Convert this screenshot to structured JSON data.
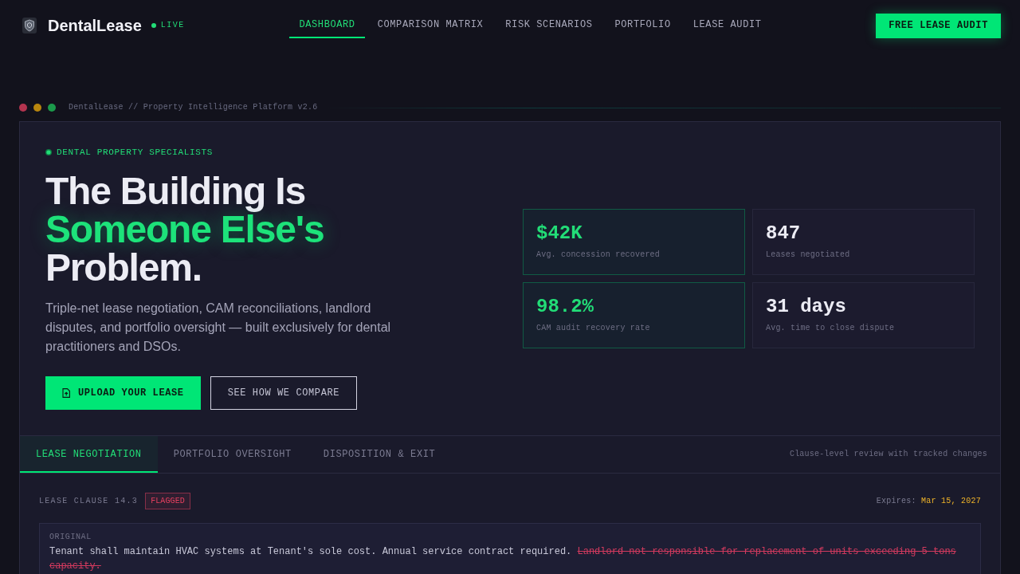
{
  "header": {
    "brand": "DentalLease",
    "status": "LIVE",
    "nav": [
      {
        "label": "DASHBOARD",
        "selected": true
      },
      {
        "label": "COMPARISON MATRIX",
        "selected": false
      },
      {
        "label": "RISK SCENARIOS",
        "selected": false
      },
      {
        "label": "PORTFOLIO",
        "selected": false
      },
      {
        "label": "LEASE AUDIT",
        "selected": false
      }
    ],
    "cta": "FREE LEASE AUDIT"
  },
  "window_bar": {
    "title": "DentalLease // Property Intelligence Platform v2.6"
  },
  "hero": {
    "eyebrow": "DENTAL PROPERTY SPECIALISTS",
    "headline": [
      {
        "text": "The Building Is",
        "accent": false
      },
      {
        "text": "Someone Else's",
        "accent": true
      },
      {
        "text": "Problem.",
        "accent": false
      }
    ],
    "description": "Triple-net lease negotiation, CAM reconciliations, landlord disputes, and portfolio oversight — built exclusively for dental practitioners and DSOs.",
    "buttons": [
      {
        "label": "UPLOAD YOUR LEASE",
        "kind": "primary"
      },
      {
        "label": "SEE HOW WE COMPARE",
        "kind": "outline"
      }
    ]
  },
  "stats": [
    {
      "value": "$42K",
      "label": "Avg. concession recovered",
      "highlight": true
    },
    {
      "value": "847",
      "label": "Leases negotiated",
      "highlight": false
    },
    {
      "value": "98.2%",
      "label": "CAM audit recovery rate",
      "highlight": true
    },
    {
      "value": "31 days",
      "label": "Avg. time to close dispute",
      "highlight": false
    }
  ],
  "tabs": {
    "items": [
      {
        "label": "LEASE NEGOTIATION",
        "selected": true
      },
      {
        "label": "PORTFOLIO OVERSIGHT",
        "selected": false
      },
      {
        "label": "DISPOSITION & EXIT",
        "selected": false
      }
    ],
    "caption": "Clause-level review with tracked changes"
  },
  "clause": {
    "label": "LEASE CLAUSE 14.3",
    "badge": "FLAGGED",
    "expires_label": "Expires:",
    "expires": "Mar 15, 2027",
    "original": {
      "heading": "ORIGINAL",
      "text": "Tenant shall maintain HVAC systems at Tenant's sole cost. Annual service contract required.",
      "struck": "Landlord not responsible for replacement of units exceeding 5 tons capacity."
    }
  }
}
